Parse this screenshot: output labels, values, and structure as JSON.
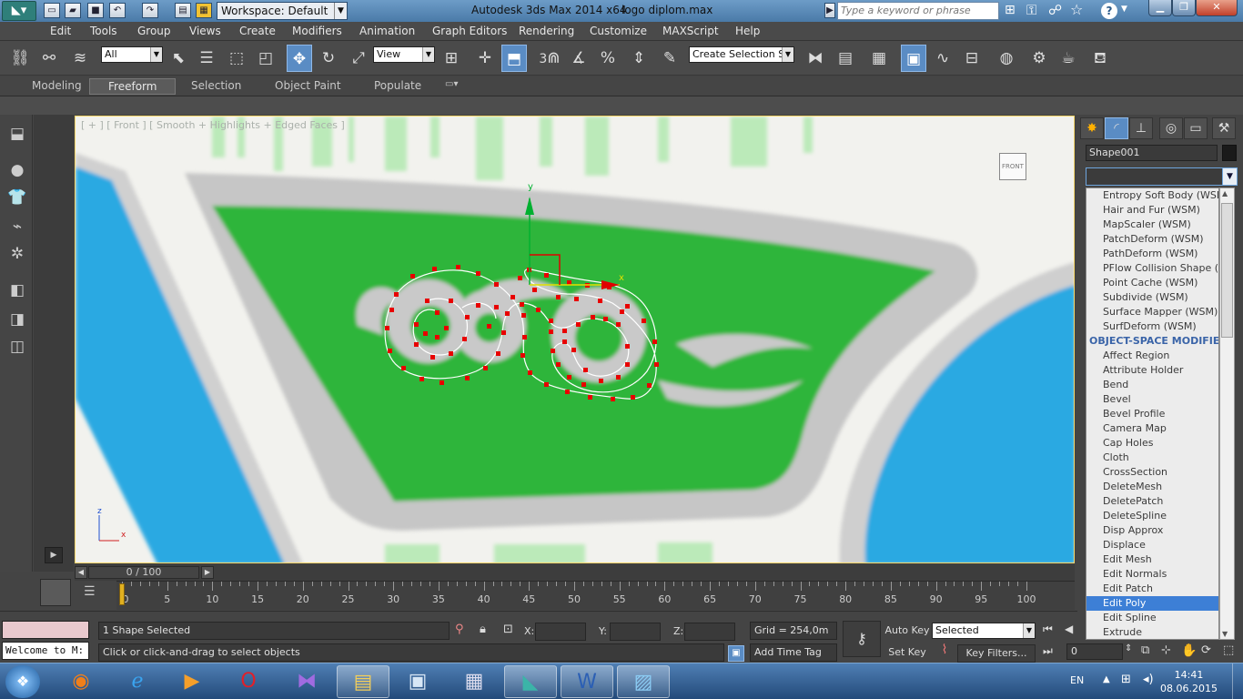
{
  "titlebar": {
    "workspace": "Workspace: Default",
    "app_title": "Autodesk 3ds Max  2014 x64",
    "file_title": "logo diplom.max",
    "search_placeholder": "Type a keyword or phrase"
  },
  "menu": [
    "Edit",
    "Tools",
    "Group",
    "Views",
    "Create",
    "Modifiers",
    "Animation",
    "Graph Editors",
    "Rendering",
    "Customize",
    "MAXScript",
    "Help"
  ],
  "toolbar": {
    "selection_filter": "All",
    "ref_coord": "View",
    "named_selection": "Create Selection Se",
    "snap_label": "3"
  },
  "ribbon": {
    "tabs": [
      "Modeling",
      "Freeform",
      "Selection",
      "Object Paint",
      "Populate"
    ],
    "active": "Freeform"
  },
  "viewport": {
    "label": "[ + ] [ Front ] [ Smooth + Highlights + Edged Faces ]",
    "viewcube": "FRONT",
    "gizmo_y": "y",
    "gizmo_x": "x",
    "axis_z": "z",
    "axis_x": "x",
    "colors": {
      "green": "#2db53a",
      "blue": "#27a7e0",
      "frame": "#c4c4c4",
      "spline": "#ffffff",
      "vertex": "#e80000"
    }
  },
  "command_panel": {
    "object_name": "Shape001",
    "modifier_list": [
      {
        "label": "Entropy Soft Body (WSM)",
        "type": "item"
      },
      {
        "label": "Hair and Fur (WSM)",
        "type": "item"
      },
      {
        "label": "MapScaler (WSM)",
        "type": "item"
      },
      {
        "label": "PatchDeform (WSM)",
        "type": "item"
      },
      {
        "label": "PathDeform (WSM)",
        "type": "item"
      },
      {
        "label": "PFlow Collision Shape (WSM)",
        "type": "item"
      },
      {
        "label": "Point Cache (WSM)",
        "type": "item"
      },
      {
        "label": "Subdivide (WSM)",
        "type": "item"
      },
      {
        "label": "Surface Mapper (WSM)",
        "type": "item"
      },
      {
        "label": "SurfDeform (WSM)",
        "type": "item"
      },
      {
        "label": "OBJECT-SPACE MODIFIERS",
        "type": "header"
      },
      {
        "label": "Affect Region",
        "type": "item"
      },
      {
        "label": "Attribute Holder",
        "type": "item"
      },
      {
        "label": "Bend",
        "type": "item"
      },
      {
        "label": "Bevel",
        "type": "item"
      },
      {
        "label": "Bevel Profile",
        "type": "item"
      },
      {
        "label": "Camera Map",
        "type": "item"
      },
      {
        "label": "Cap Holes",
        "type": "item"
      },
      {
        "label": "Cloth",
        "type": "item"
      },
      {
        "label": "CrossSection",
        "type": "item"
      },
      {
        "label": "DeleteMesh",
        "type": "item"
      },
      {
        "label": "DeletePatch",
        "type": "item"
      },
      {
        "label": "DeleteSpline",
        "type": "item"
      },
      {
        "label": "Disp Approx",
        "type": "item"
      },
      {
        "label": "Displace",
        "type": "item"
      },
      {
        "label": "Edit Mesh",
        "type": "item"
      },
      {
        "label": "Edit Normals",
        "type": "item"
      },
      {
        "label": "Edit Patch",
        "type": "item"
      },
      {
        "label": "Edit Poly",
        "type": "item",
        "selected": true
      },
      {
        "label": "Edit Spline",
        "type": "item"
      },
      {
        "label": "Extrude",
        "type": "item"
      }
    ]
  },
  "timeline": {
    "frame_indicator": "0 / 100",
    "ticks": [
      0,
      5,
      10,
      15,
      20,
      25,
      30,
      35,
      40,
      45,
      50,
      55,
      60,
      65,
      70,
      75,
      80,
      85,
      90,
      95,
      100
    ]
  },
  "status": {
    "maxscript_listener": "Welcome to M:",
    "selection_info": "1 Shape Selected",
    "prompt": "Click or click-and-drag to select objects",
    "x_label": "X:",
    "y_label": "Y:",
    "z_label": "Z:",
    "grid": "Grid = 254,0m",
    "add_time_tag": "Add Time Tag",
    "auto_key": "Auto Key",
    "set_key": "Set Key",
    "key_mode": "Selected",
    "key_filters": "Key Filters...",
    "current_frame": "0"
  },
  "taskbar": {
    "language": "EN",
    "time": "14:41",
    "date": "08.06.2015"
  }
}
